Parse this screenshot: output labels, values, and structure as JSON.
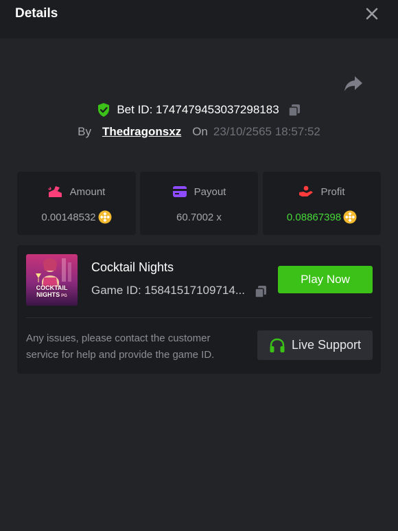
{
  "header": {
    "title": "Details",
    "close_icon": "close-icon"
  },
  "bet": {
    "share_icon": "share-icon",
    "verified_icon": "shield-check-icon",
    "bet_id_text": "Bet ID: 1747479453037298183",
    "copy_icon": "copy-icon",
    "by_label": "By",
    "username": "Thedragonsxz",
    "on_label": "On",
    "datetime": "23/10/2565 18:57:52"
  },
  "stats": [
    {
      "label": "Amount",
      "value": "0.00148532",
      "icon": "amount-icon",
      "coin_icon": "bnb-coin-icon"
    },
    {
      "label": "Payout",
      "value": "60.7002 x",
      "icon": "payout-card-icon"
    },
    {
      "label": "Profit",
      "value": "0.08867398",
      "icon": "profit-hand-icon",
      "coin_icon": "bnb-coin-icon"
    }
  ],
  "colors": {
    "background": "#232427",
    "header": "#1c1d20",
    "card": "#1b1c1f",
    "accent_green": "#3bc117",
    "profit_green": "#47d83a",
    "amount_icon": "#ff3f7a",
    "payout_icon": "#8f4bff",
    "profit_icon": "#ff3b3b",
    "coin": "#f3ba2f"
  },
  "game": {
    "thumb_label_line1": "COCKTAIL",
    "thumb_label_line2": "NIGHTS",
    "thumb_brand": "PG",
    "name": "Cocktail Nights",
    "game_id_text": "Game ID: 15841517109714...",
    "play_label": "Play Now",
    "help_text": "Any issues, please contact the customer service for help and provide the game ID.",
    "support_label": "Live Support",
    "support_icon": "headset-icon"
  }
}
